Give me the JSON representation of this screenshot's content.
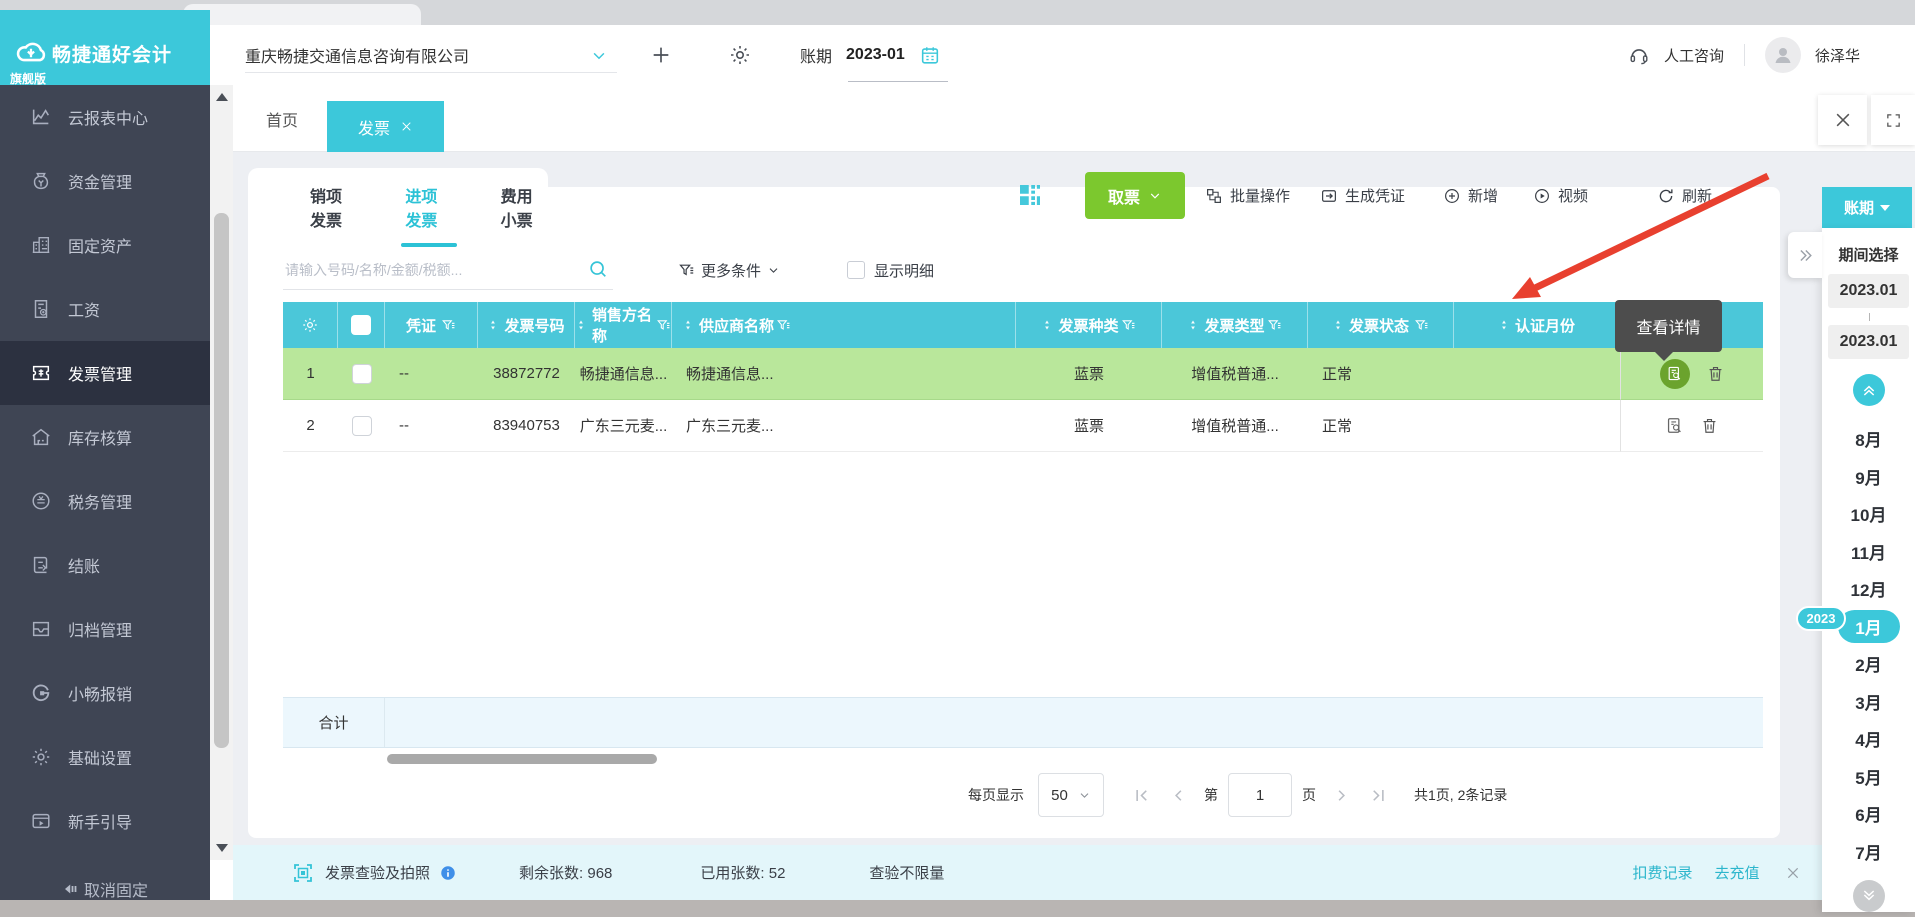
{
  "brand": {
    "title": "畅捷通好会计",
    "edition": "旗舰版"
  },
  "topbar": {
    "company": "重庆畅捷交通信息咨询有限公司",
    "period_label": "账期",
    "period_value": "2023-01",
    "support": "人工咨询",
    "username": "徐泽华"
  },
  "sidebar": {
    "items": [
      "云报表中心",
      "资金管理",
      "固定资产",
      "工资",
      "发票管理",
      "库存核算",
      "税务管理",
      "结账",
      "归档管理",
      "小畅报销",
      "基础设置",
      "新手引导"
    ],
    "unpin": "取消固定"
  },
  "tabs": {
    "home": "首页",
    "invoice": "发票"
  },
  "subtabs": {
    "items": [
      "销项发票",
      "进项发票",
      "费用小票"
    ]
  },
  "toolbar": {
    "get_ticket": "取票",
    "batch": "批量操作",
    "generate_voucher": "生成凭证",
    "add": "新增",
    "video": "视频",
    "refresh": "刷新"
  },
  "filterbar": {
    "search_placeholder": "请输入号码/名称/金额/税额...",
    "more_filters": "更多条件",
    "show_detail": "显示明细"
  },
  "table": {
    "headers": {
      "voucher": "凭证",
      "invoice_no": "发票号码",
      "seller": "销售方名称",
      "supplier": "供应商名称",
      "kind": "发票种类",
      "type": "发票类型",
      "status": "发票状态",
      "auth_month": "认证月份"
    },
    "rows": [
      {
        "no": "1",
        "voucher": "--",
        "invoice_no": "38872772",
        "seller": "畅捷通信息...",
        "supplier": "畅捷通信息...",
        "kind": "蓝票",
        "type": "增值税普通...",
        "status": "正常",
        "auth_month": ""
      },
      {
        "no": "2",
        "voucher": "--",
        "invoice_no": "83940753",
        "seller": "广东三元麦...",
        "supplier": "广东三元麦...",
        "kind": "蓝票",
        "type": "增值税普通...",
        "status": "正常",
        "auth_month": ""
      }
    ],
    "total_label": "合计"
  },
  "tooltip": {
    "text": "查看详情"
  },
  "pagination": {
    "per_page_label": "每页显示",
    "per_page": "50",
    "page_prefix": "第",
    "page": "1",
    "page_suffix": "页",
    "summary": "共1页, 2条记录"
  },
  "bottombar": {
    "title": "发票查验及拍照",
    "remaining": "剩余张数: 968",
    "used": "已用张数: 52",
    "unlimited": "查验不限量",
    "fee_record": "扣费记录",
    "recharge": "去充值"
  },
  "right_panel": {
    "period_button": "账期",
    "title": "期间选择",
    "range_start": "2023.01",
    "range_end": "2023.01",
    "year_badge": "2023",
    "months": [
      "8月",
      "9月",
      "10月",
      "11月",
      "12月",
      "1月",
      "2月",
      "3月",
      "4月",
      "5月",
      "6月",
      "7月"
    ]
  },
  "colors": {
    "accent": "#3cc8da",
    "table_header": "#4bc7d9",
    "green_button": "#7cc82e",
    "row_highlight": "#b9e79b",
    "sidebar_bg": "#3f4554",
    "tooltip_bg": "#4d4d4d",
    "arrow_red": "#e8402f"
  }
}
